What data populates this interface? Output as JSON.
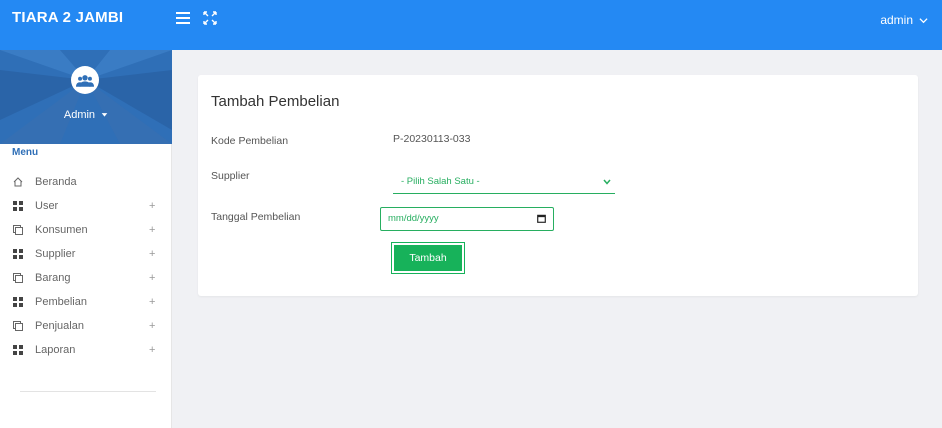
{
  "header": {
    "brand": "TIARA 2 JAMBI",
    "user": "admin",
    "icons": [
      "hamburger-icon",
      "fullscreen-icon",
      "chevron-down-icon"
    ]
  },
  "sidebar": {
    "profile_name": "Admin",
    "menu_heading": "Menu",
    "items": [
      {
        "label": "Beranda",
        "icon": "home-icon",
        "expandable": false
      },
      {
        "label": "User",
        "icon": "grid-icon",
        "expandable": true
      },
      {
        "label": "Konsumen",
        "icon": "window-icon",
        "expandable": true
      },
      {
        "label": "Supplier",
        "icon": "grid-icon",
        "expandable": true
      },
      {
        "label": "Barang",
        "icon": "window-icon",
        "expandable": true
      },
      {
        "label": "Pembelian",
        "icon": "grid-icon",
        "expandable": true
      },
      {
        "label": "Penjualan",
        "icon": "window-icon",
        "expandable": true
      },
      {
        "label": "Laporan",
        "icon": "grid-icon",
        "expandable": true
      }
    ],
    "expand_symbol": "+"
  },
  "form": {
    "title": "Tambah Pembelian",
    "kode_label": "Kode Pembelian",
    "kode_value": "P-20230113-033",
    "supplier_label": "Supplier",
    "supplier_selected": "- Pilih Salah Satu -",
    "tanggal_label": "Tanggal Pembelian",
    "tanggal_placeholder": "mm/dd/yyyy",
    "submit_label": "Tambah"
  },
  "colors": {
    "topbar": "#2489f3",
    "sidebar_profile": "#2f6fb7",
    "accent_green": "#17b25a"
  }
}
